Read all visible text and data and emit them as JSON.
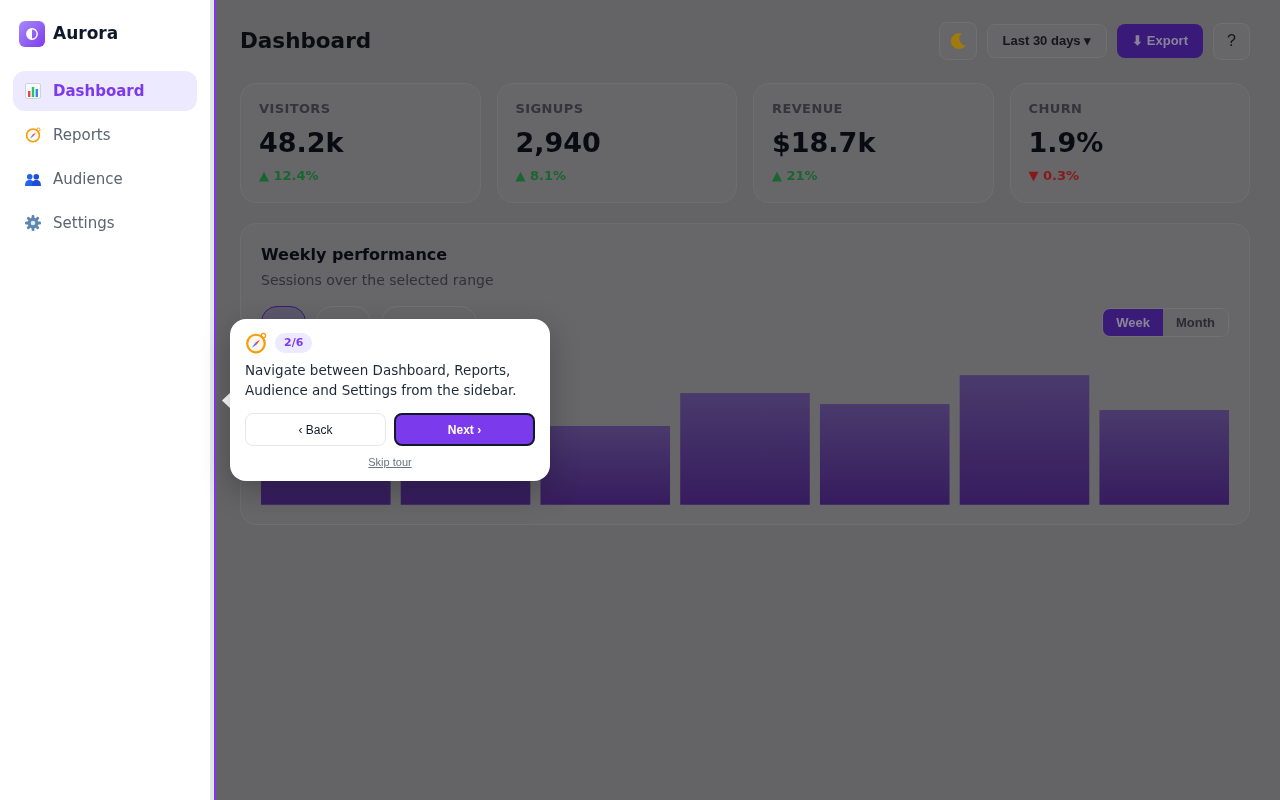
{
  "sidebar": {
    "brand": "Aurora",
    "items": [
      {
        "label": "Dashboard",
        "selected": true
      },
      {
        "label": "Reports",
        "selected": false
      },
      {
        "label": "Audience",
        "selected": false
      },
      {
        "label": "Settings",
        "selected": false
      }
    ]
  },
  "header": {
    "title": "Dashboard",
    "range": "Last 30 days ▾",
    "export": "⬇ Export",
    "help": "?"
  },
  "stats": [
    {
      "label": "VISITORS",
      "value": "48.2k",
      "delta": "▲ 12.4%",
      "negative": false
    },
    {
      "label": "SIGNUPS",
      "value": "2,940",
      "delta": "▲ 8.1%",
      "negative": false
    },
    {
      "label": "REVENUE",
      "value": "$18.7k",
      "delta": "▲ 21%",
      "negative": false
    },
    {
      "label": "CHURN",
      "value": "1.9%",
      "delta": "▼ 0.3%",
      "negative": true
    }
  ],
  "chart": {
    "title": "Weekly performance",
    "subtitle": "Sessions over the selected range",
    "filters": [
      {
        "selected": true
      },
      {
        "selected": false
      },
      {
        "selected": false
      }
    ],
    "periods": [
      {
        "label": "Week",
        "selected": true
      },
      {
        "label": "Month",
        "selected": false
      }
    ]
  },
  "tour": {
    "step": "2/6",
    "text": "Navigate between Dashboard, Reports, Audience and Settings from the sidebar.",
    "back": "‹ Back",
    "next": "Next ›",
    "skip": "Skip tour"
  }
}
